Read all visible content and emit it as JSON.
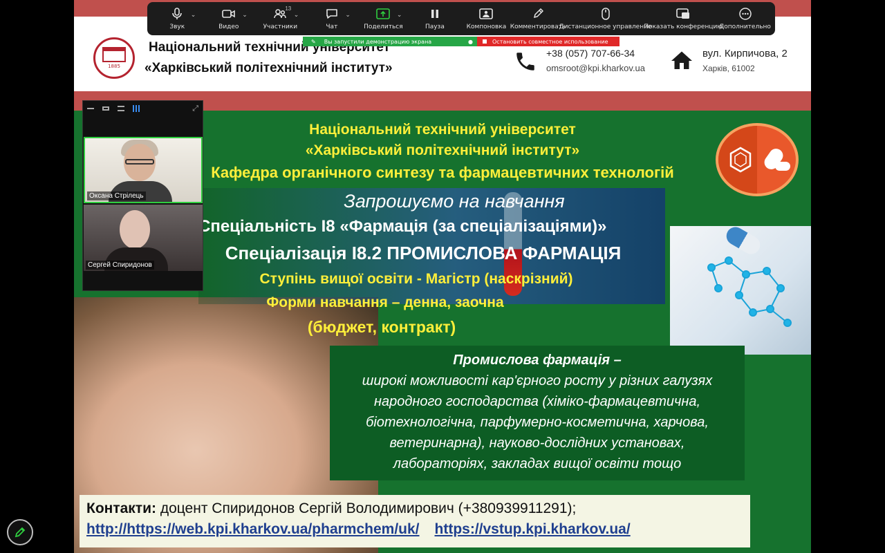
{
  "header": {
    "logo_year": "1885",
    "university_line1": "Національний технічний університет",
    "university_line2": "«Харківський політехнічний інститут»",
    "phone": "+38 (057) 707-66-34",
    "email": "omsroot@kpi.kharkov.ua",
    "address_line1": "вул. Кирпичова, 2",
    "address_line2": "Харків, 61002"
  },
  "toolbar": {
    "items": [
      {
        "label": "Звук",
        "icon": "microphone-icon"
      },
      {
        "label": "Видео",
        "icon": "video-camera-icon"
      },
      {
        "label": "Участники",
        "icon": "participants-icon",
        "count": "13"
      },
      {
        "label": "Чат",
        "icon": "chat-icon"
      },
      {
        "label": "Поделиться",
        "icon": "share-screen-icon"
      },
      {
        "label": "Пауза",
        "icon": "pause-icon"
      },
      {
        "label": "Компоновка",
        "icon": "layout-icon"
      },
      {
        "label": "Комментировать",
        "icon": "annotate-pen-icon"
      },
      {
        "label": "Дистанционное управление",
        "icon": "remote-control-mouse-icon"
      },
      {
        "label": "Показать конференцию",
        "icon": "show-meeting-icon"
      },
      {
        "label": "Дополнительно",
        "icon": "more-icon"
      }
    ],
    "share_status": "Вы запустили демонстрацию экрана",
    "stop_share": "Остановить совместное использование"
  },
  "participants": [
    {
      "name": "Оксана Стрілець"
    },
    {
      "name": "Сергей Спиридонов"
    }
  ],
  "poster": {
    "line1": "Національний технічний університет",
    "line2": "«Харківський політехнічний інститут»",
    "line3": "Кафедра органічного синтезу та фармацевтичних технологій",
    "invite": "Запрошуємо на навчання",
    "specialty": "Спеціальність І8 «Фармація (за спеціалізаціями)»",
    "specialization": "Спеціалізація І8.2 ПРОМИСЛОВА ФАРМАЦІЯ",
    "degree": "Ступінь вищої освіти - Магістр (наскрізний)",
    "study_forms": "Форми навчання – денна, заочна",
    "funding": "(бюджет, контракт)",
    "desc_title": "Промислова фармація –",
    "desc_lines": [
      "широкі можливості кар'єрного росту у різних галузях",
      "народного господарства (хіміко-фармацевтична,",
      "біотехнологічна, парфумерно-косметична, харчова,",
      "ветеринарна), науково-дослідних установах,",
      "лабораторіях, закладах вищої освіти тощо"
    ],
    "contacts_label": "Контакти:",
    "contacts_text": " доцент Спиридонов Сергій Володимирович (+380939911291);",
    "link1": "http://https://web.kpi.kharkov.ua/pharmchem/uk/",
    "link2": "https://vstup.kpi.kharkov.ua/"
  },
  "colors": {
    "brand_red": "#c0504d",
    "poster_green": "#16722e",
    "highlight_yellow": "#ffef3a",
    "share_green": "#26a646",
    "stop_red": "#e02828"
  }
}
